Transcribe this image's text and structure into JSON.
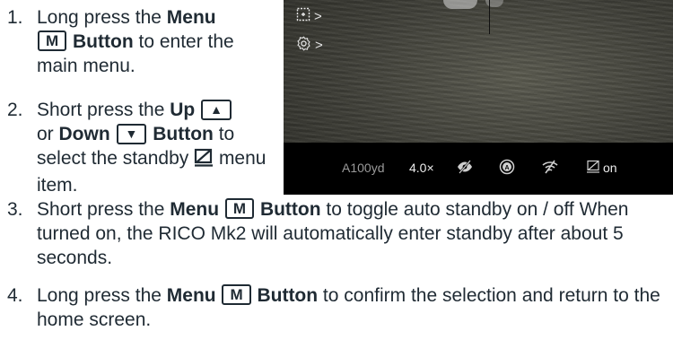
{
  "steps": [
    {
      "num": "1.",
      "t1": "Long press the ",
      "b1": "Menu",
      "key": "M",
      "b2": "Button",
      "t2": " to enter the main menu."
    },
    {
      "num": "2.",
      "t1": "Short press the ",
      "b1": "Up",
      "or": " or ",
      "b2": "Down",
      "b3": "Button",
      "t2": " to select the standby ",
      "t3": " menu item."
    },
    {
      "num": "3.",
      "t1": "Short press the ",
      "b1": "Menu",
      "key": "M",
      "b2": "Button",
      "t2": " to toggle auto standby on / off When turned on, the RICO Mk2 will automatically enter standby after about 5 seconds."
    },
    {
      "num": "4.",
      "t1": "Long press the ",
      "b1": "Menu",
      "key": "M",
      "b2": "Button",
      "t2": " to confirm the selection and return to the home screen."
    }
  ],
  "screen": {
    "menu_arrow": ">",
    "status": {
      "range": "A100yd",
      "zoom": "4.0×",
      "standby": "on"
    }
  },
  "icons": [
    "standby-icon",
    "crop-icon",
    "gear-icon",
    "eye-off-icon",
    "auto-mode-icon",
    "wifi-off-icon"
  ]
}
